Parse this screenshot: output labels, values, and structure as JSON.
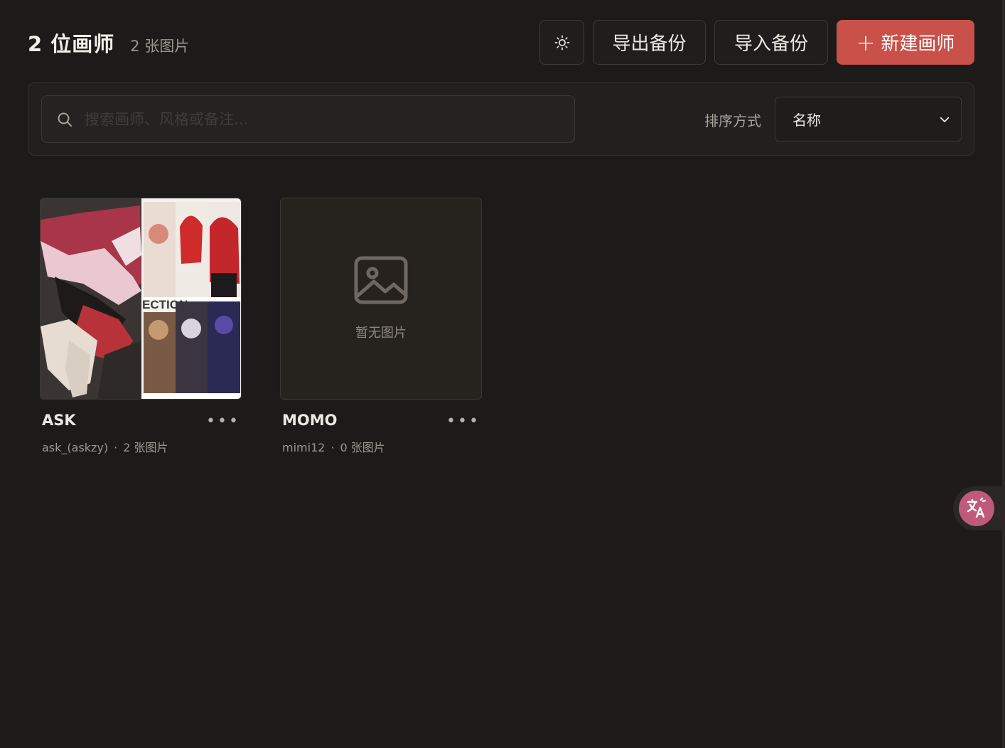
{
  "header": {
    "title": "2 位画师",
    "subtitle": "2 张图片",
    "export_label": "导出备份",
    "import_label": "导入备份",
    "new_label": "新建画师",
    "theme_icon": "sun-icon"
  },
  "filter": {
    "search_placeholder": "搜索画师、风格或备注...",
    "search_value": "",
    "sort_label": "排序方式",
    "sort_value": "名称"
  },
  "artists": [
    {
      "name": "ASK",
      "handle": "ask_(askzy)",
      "dot": "·",
      "count": "2 张图片",
      "has_images": true
    },
    {
      "name": "MOMO",
      "handle": "mimi12",
      "dot": "·",
      "count": "0 张图片",
      "has_images": false,
      "empty_text": "暂无图片"
    }
  ],
  "colors": {
    "background": "#1c1b1a",
    "accent": "#c9514a",
    "translate_button": "#c05a7a"
  },
  "floating": {
    "icon": "translate-icon"
  }
}
